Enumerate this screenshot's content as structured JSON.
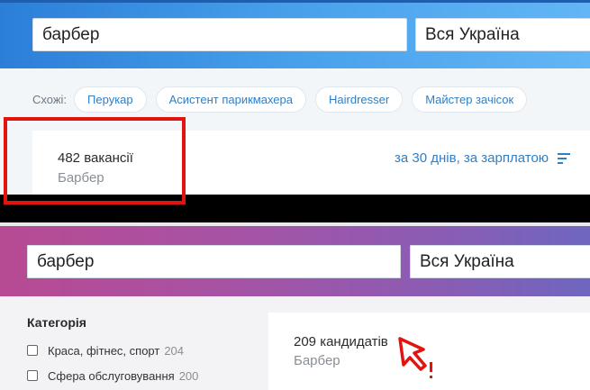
{
  "top_panel": {
    "search": {
      "value": "барбер"
    },
    "region": {
      "value": "Вся Україна"
    },
    "similar": {
      "label": "Схожі:",
      "chips": [
        "Перукар",
        "Асистент парикмахера",
        "Hairdresser",
        "Майстер зачісок"
      ]
    },
    "result": {
      "count": "482 вакансії",
      "subtitle": "Барбер",
      "sort": "за 30 днів, за зарплатою"
    },
    "highlight_color": "#e3140f"
  },
  "bottom_panel": {
    "search": {
      "value": "барбер"
    },
    "region": {
      "value": "Вся Україна"
    },
    "sidebar": {
      "title": "Категорія",
      "items": [
        {
          "label": "Краса, фітнес, спорт",
          "count": "204"
        },
        {
          "label": "Сфера обслуговування",
          "count": "200"
        }
      ]
    },
    "result": {
      "count": "209 кандидатів",
      "subtitle": "Барбер"
    },
    "cursor_icon": "click-cursor-icon",
    "cursor_color": "#e3140f"
  }
}
